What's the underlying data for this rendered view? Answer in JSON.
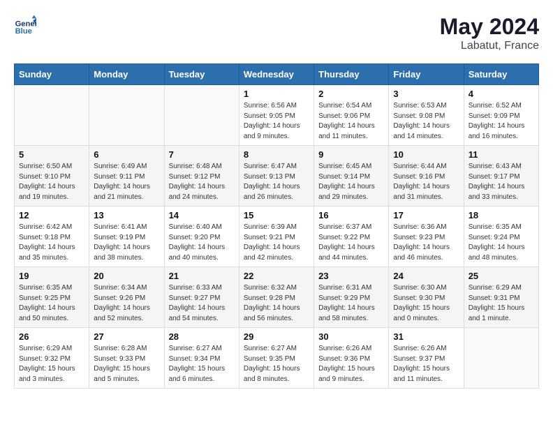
{
  "logo": {
    "line1": "General",
    "line2": "Blue"
  },
  "title": {
    "month_year": "May 2024",
    "location": "Labatut, France"
  },
  "days_header": [
    "Sunday",
    "Monday",
    "Tuesday",
    "Wednesday",
    "Thursday",
    "Friday",
    "Saturday"
  ],
  "weeks": [
    [
      {
        "day": "",
        "info": ""
      },
      {
        "day": "",
        "info": ""
      },
      {
        "day": "",
        "info": ""
      },
      {
        "day": "1",
        "info": "Sunrise: 6:56 AM\nSunset: 9:05 PM\nDaylight: 14 hours and 9 minutes."
      },
      {
        "day": "2",
        "info": "Sunrise: 6:54 AM\nSunset: 9:06 PM\nDaylight: 14 hours and 11 minutes."
      },
      {
        "day": "3",
        "info": "Sunrise: 6:53 AM\nSunset: 9:08 PM\nDaylight: 14 hours and 14 minutes."
      },
      {
        "day": "4",
        "info": "Sunrise: 6:52 AM\nSunset: 9:09 PM\nDaylight: 14 hours and 16 minutes."
      }
    ],
    [
      {
        "day": "5",
        "info": "Sunrise: 6:50 AM\nSunset: 9:10 PM\nDaylight: 14 hours and 19 minutes."
      },
      {
        "day": "6",
        "info": "Sunrise: 6:49 AM\nSunset: 9:11 PM\nDaylight: 14 hours and 21 minutes."
      },
      {
        "day": "7",
        "info": "Sunrise: 6:48 AM\nSunset: 9:12 PM\nDaylight: 14 hours and 24 minutes."
      },
      {
        "day": "8",
        "info": "Sunrise: 6:47 AM\nSunset: 9:13 PM\nDaylight: 14 hours and 26 minutes."
      },
      {
        "day": "9",
        "info": "Sunrise: 6:45 AM\nSunset: 9:14 PM\nDaylight: 14 hours and 29 minutes."
      },
      {
        "day": "10",
        "info": "Sunrise: 6:44 AM\nSunset: 9:16 PM\nDaylight: 14 hours and 31 minutes."
      },
      {
        "day": "11",
        "info": "Sunrise: 6:43 AM\nSunset: 9:17 PM\nDaylight: 14 hours and 33 minutes."
      }
    ],
    [
      {
        "day": "12",
        "info": "Sunrise: 6:42 AM\nSunset: 9:18 PM\nDaylight: 14 hours and 35 minutes."
      },
      {
        "day": "13",
        "info": "Sunrise: 6:41 AM\nSunset: 9:19 PM\nDaylight: 14 hours and 38 minutes."
      },
      {
        "day": "14",
        "info": "Sunrise: 6:40 AM\nSunset: 9:20 PM\nDaylight: 14 hours and 40 minutes."
      },
      {
        "day": "15",
        "info": "Sunrise: 6:39 AM\nSunset: 9:21 PM\nDaylight: 14 hours and 42 minutes."
      },
      {
        "day": "16",
        "info": "Sunrise: 6:37 AM\nSunset: 9:22 PM\nDaylight: 14 hours and 44 minutes."
      },
      {
        "day": "17",
        "info": "Sunrise: 6:36 AM\nSunset: 9:23 PM\nDaylight: 14 hours and 46 minutes."
      },
      {
        "day": "18",
        "info": "Sunrise: 6:35 AM\nSunset: 9:24 PM\nDaylight: 14 hours and 48 minutes."
      }
    ],
    [
      {
        "day": "19",
        "info": "Sunrise: 6:35 AM\nSunset: 9:25 PM\nDaylight: 14 hours and 50 minutes."
      },
      {
        "day": "20",
        "info": "Sunrise: 6:34 AM\nSunset: 9:26 PM\nDaylight: 14 hours and 52 minutes."
      },
      {
        "day": "21",
        "info": "Sunrise: 6:33 AM\nSunset: 9:27 PM\nDaylight: 14 hours and 54 minutes."
      },
      {
        "day": "22",
        "info": "Sunrise: 6:32 AM\nSunset: 9:28 PM\nDaylight: 14 hours and 56 minutes."
      },
      {
        "day": "23",
        "info": "Sunrise: 6:31 AM\nSunset: 9:29 PM\nDaylight: 14 hours and 58 minutes."
      },
      {
        "day": "24",
        "info": "Sunrise: 6:30 AM\nSunset: 9:30 PM\nDaylight: 15 hours and 0 minutes."
      },
      {
        "day": "25",
        "info": "Sunrise: 6:29 AM\nSunset: 9:31 PM\nDaylight: 15 hours and 1 minute."
      }
    ],
    [
      {
        "day": "26",
        "info": "Sunrise: 6:29 AM\nSunset: 9:32 PM\nDaylight: 15 hours and 3 minutes."
      },
      {
        "day": "27",
        "info": "Sunrise: 6:28 AM\nSunset: 9:33 PM\nDaylight: 15 hours and 5 minutes."
      },
      {
        "day": "28",
        "info": "Sunrise: 6:27 AM\nSunset: 9:34 PM\nDaylight: 15 hours and 6 minutes."
      },
      {
        "day": "29",
        "info": "Sunrise: 6:27 AM\nSunset: 9:35 PM\nDaylight: 15 hours and 8 minutes."
      },
      {
        "day": "30",
        "info": "Sunrise: 6:26 AM\nSunset: 9:36 PM\nDaylight: 15 hours and 9 minutes."
      },
      {
        "day": "31",
        "info": "Sunrise: 6:26 AM\nSunset: 9:37 PM\nDaylight: 15 hours and 11 minutes."
      },
      {
        "day": "",
        "info": ""
      }
    ]
  ]
}
